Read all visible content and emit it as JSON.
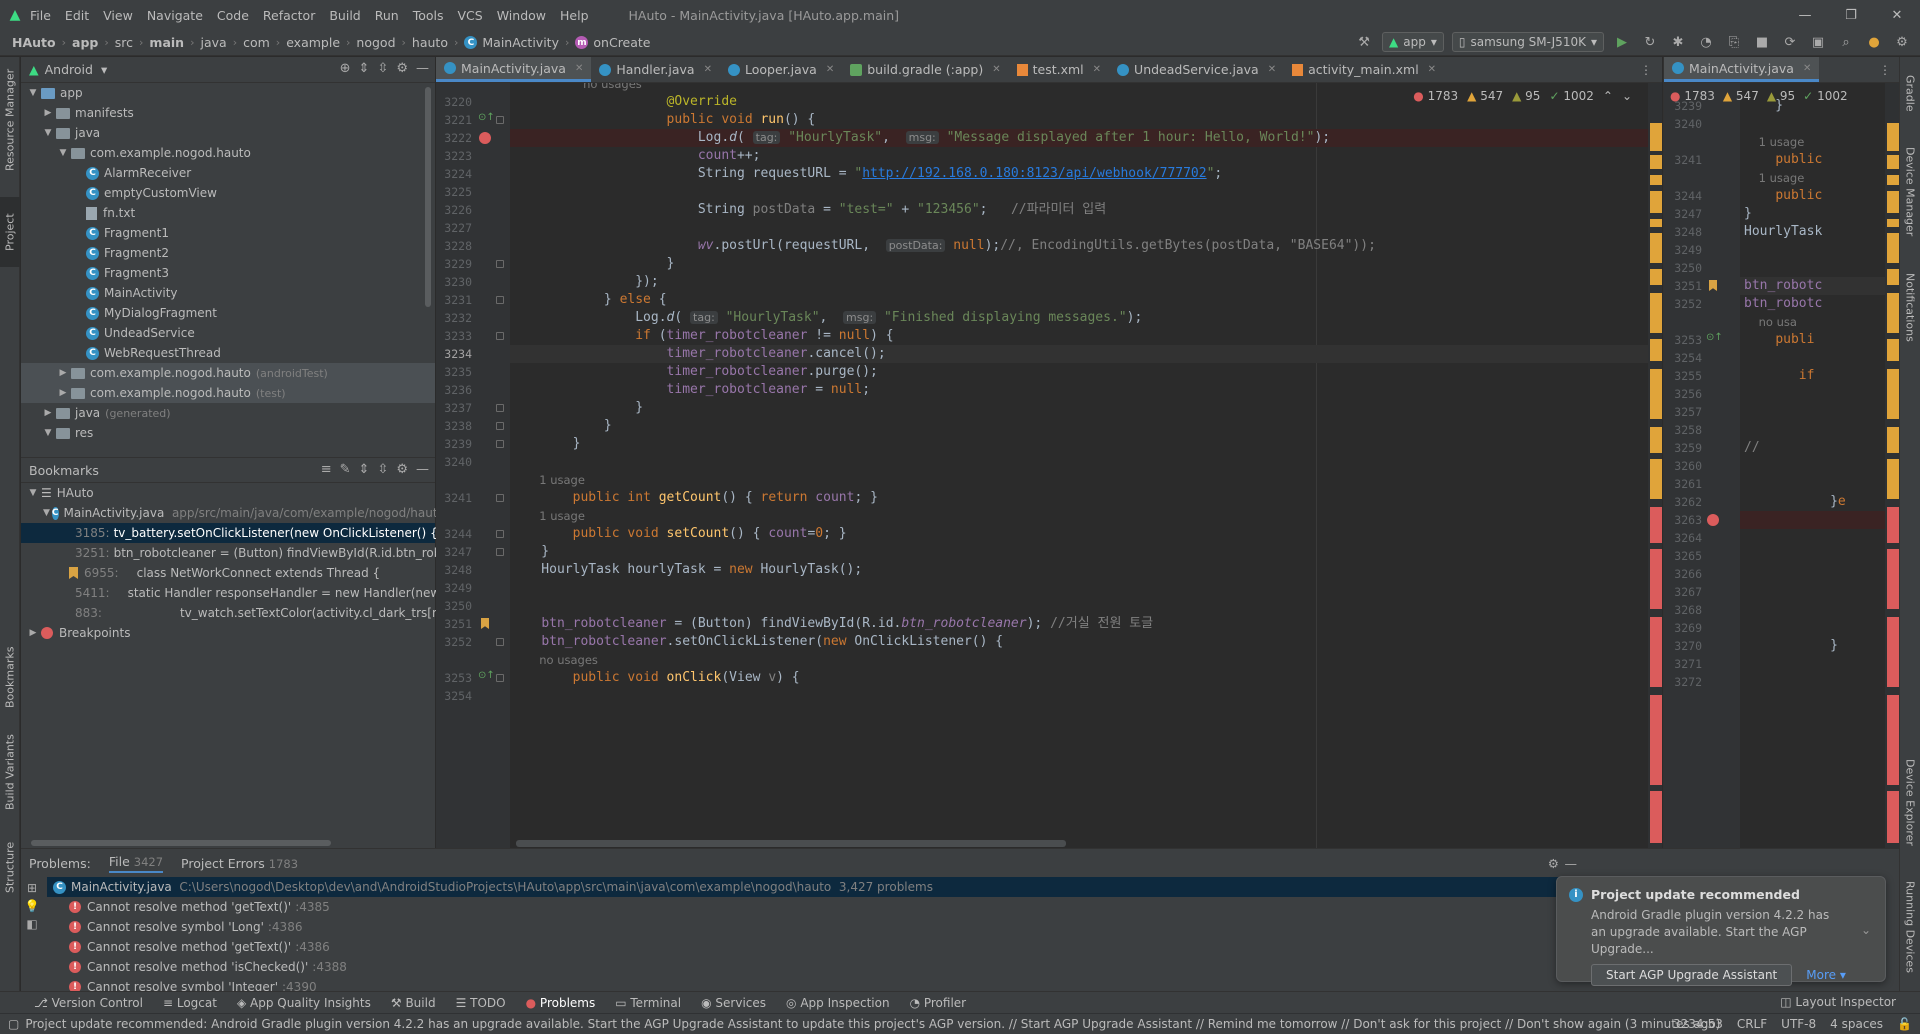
{
  "menu": [
    "File",
    "Edit",
    "View",
    "Navigate",
    "Code",
    "Refactor",
    "Build",
    "Run",
    "Tools",
    "VCS",
    "Window",
    "Help"
  ],
  "window_title": "HAuto - MainActivity.java [HAuto.app.main]",
  "breadcrumbs": [
    "HAuto",
    "app",
    "src",
    "main",
    "java",
    "com",
    "example",
    "nogod",
    "hauto",
    "MainActivity",
    "onCreate"
  ],
  "run_config": "app",
  "device": "samsung SM-J510K",
  "project_panel": {
    "view_mode": "Android",
    "tree": [
      {
        "label": "app",
        "extra": "",
        "icon": "folder"
      },
      {
        "label": "manifests",
        "extra": "",
        "icon": "folder"
      },
      {
        "label": "java",
        "extra": "",
        "icon": "folder"
      },
      {
        "label": "com.example.nogod.hauto",
        "extra": "",
        "icon": "package"
      },
      {
        "label": "AlarmReceiver",
        "extra": "",
        "icon": "class"
      },
      {
        "label": "emptyCustomView",
        "extra": "",
        "icon": "class"
      },
      {
        "label": "fn.txt",
        "extra": "",
        "icon": "file"
      },
      {
        "label": "Fragment1",
        "extra": "",
        "icon": "class"
      },
      {
        "label": "Fragment2",
        "extra": "",
        "icon": "class"
      },
      {
        "label": "Fragment3",
        "extra": "",
        "icon": "class"
      },
      {
        "label": "MainActivity",
        "extra": "",
        "icon": "class"
      },
      {
        "label": "MyDialogFragment",
        "extra": "",
        "icon": "class"
      },
      {
        "label": "UndeadService",
        "extra": "",
        "icon": "class"
      },
      {
        "label": "WebRequestThread",
        "extra": "",
        "icon": "class"
      },
      {
        "label": "com.example.nogod.hauto",
        "extra": "(androidTest)",
        "icon": "package"
      },
      {
        "label": "com.example.nogod.hauto",
        "extra": "(test)",
        "icon": "package"
      },
      {
        "label": "java",
        "extra": "(generated)",
        "icon": "folder"
      },
      {
        "label": "res",
        "extra": "",
        "icon": "folder"
      }
    ]
  },
  "bookmarks_panel": {
    "title": "Bookmarks",
    "root": "HAuto",
    "file": "MainActivity.java",
    "file_path": "app/src/main/java/com/example/nogod/hauto",
    "items": [
      {
        "line": "3185:",
        "text": "tv_battery.setOnClickListener(new OnClickListener() {"
      },
      {
        "line": "3251:",
        "text": "btn_robotcleaner = (Button) findViewById(R.id.btn_robo"
      },
      {
        "line": "6955:",
        "text": "class NetWorkConnect extends Thread {"
      },
      {
        "line": "5411:",
        "text": "static Handler responseHandler = new Handler(new H"
      },
      {
        "line": "883:",
        "text": "tv_watch.setTextColor(activity.cl_dark_trs[m"
      }
    ],
    "breakpoints": "Breakpoints"
  },
  "editor_tabs": [
    "MainActivity.java",
    "Handler.java",
    "Looper.java",
    "build.gradle (:app)",
    "test.xml",
    "UndeadService.java",
    "activity_main.xml"
  ],
  "split_tab": "MainActivity.java",
  "inspections": {
    "errors": "1783",
    "warnings": "547",
    "weak": "95",
    "ok": "1002"
  },
  "code_lines": [
    {
      "n": "",
      "html": "<span class=\"hint\">                    no usages</span>"
    },
    {
      "n": "3220",
      "html": "                    <span class=\"ann\">@Override</span>"
    },
    {
      "n": "3221",
      "html": "                    <span class=\"kw\">public void</span> <span class=\"fn\">run</span>() {"
    },
    {
      "n": "3222",
      "html": "                        Log.<span class=\"ital\">d</span>( <span class=\"inl\">tag:</span> <span class=\"str\">\"HourlyTask\"</span>,  <span class=\"inl\">msg:</span> <span class=\"str\">\"Message displayed after 1 hour: Hello, World!\"</span>);"
    },
    {
      "n": "3223",
      "html": "                        <span class=\"fld\">count</span>++;"
    },
    {
      "n": "3224",
      "html": "                        String requestURL = <span class=\"str\">\"<span class=\"url\">http://192.168.0.180:8123/api/webhook/777702</span>\"</span>;"
    },
    {
      "n": "3225",
      "html": ""
    },
    {
      "n": "3226",
      "html": "                        String <span class=\"cmt\">postData</span> = <span class=\"str\">\"test=\"</span> + <span class=\"str\">\"123456\"</span>;   <span class=\"cmt\">//파라미터 입력</span>"
    },
    {
      "n": "3227",
      "html": ""
    },
    {
      "n": "3228",
      "html": "                        <span class=\"fld ital\">wv</span>.postUrl(requestURL,  <span class=\"inl\">postData:</span> <span class=\"kw\">null</span>);<span class=\"cmt\">//, EncodingUtils.getBytes(postData, \"BASE64\"));</span>"
    },
    {
      "n": "3229",
      "html": "                    }"
    },
    {
      "n": "3230",
      "html": "                });"
    },
    {
      "n": "3231",
      "html": "            } <span class=\"kw\">else</span> {"
    },
    {
      "n": "3232",
      "html": "                Log.<span class=\"ital\">d</span>( <span class=\"inl\">tag:</span> <span class=\"str\">\"HourlyTask\"</span>,  <span class=\"inl\">msg:</span> <span class=\"str\">\"Finished displaying messages.\"</span>);"
    },
    {
      "n": "3233",
      "html": "                <span class=\"kw\">if</span> (<span class=\"fld\">timer_robotcleaner</span> != <span class=\"kw\">null</span>) {"
    },
    {
      "n": "3234",
      "html": "                    <span class=\"fld\">timer_robotcleaner</span>.cancel();"
    },
    {
      "n": "3235",
      "html": "                    <span class=\"fld\">timer_robotcleaner</span>.purge();"
    },
    {
      "n": "3236",
      "html": "                    <span class=\"fld\">timer_robotcleaner</span> = <span class=\"kw\">null</span>;"
    },
    {
      "n": "3237",
      "html": "                }"
    },
    {
      "n": "3238",
      "html": "            }"
    },
    {
      "n": "3239",
      "html": "        }"
    },
    {
      "n": "3240",
      "html": ""
    },
    {
      "n": "",
      "html": "<span class=\"hint\">        1 usage</span>"
    },
    {
      "n": "3241",
      "html": "        <span class=\"kw\">public int</span> <span class=\"fn\">getCount</span>() { <span class=\"kw\">return</span> <span class=\"fld\">count</span>; }"
    },
    {
      "n": "",
      "html": "<span class=\"hint\">        1 usage</span>"
    },
    {
      "n": "3244",
      "html": "        <span class=\"kw\">public void</span> <span class=\"fn\">setCount</span>() { <span class=\"fld\">count</span>=<span class=\"kw\">0</span>; }"
    },
    {
      "n": "3247",
      "html": "    }"
    },
    {
      "n": "3248",
      "html": "    HourlyTask hourlyTask = <span class=\"kw\">new</span> HourlyTask();"
    },
    {
      "n": "3249",
      "html": ""
    },
    {
      "n": "3250",
      "html": ""
    },
    {
      "n": "3251",
      "html": "    <span class=\"fld\">btn_robotcleaner</span> = (Button) findViewById(R.id.<span class=\"fld ital\">btn_robotcleaner</span>); <span class=\"cmt\">//거실 전원 토글</span>"
    },
    {
      "n": "3252",
      "html": "    <span class=\"fld\">btn_robotcleaner</span>.setOnClickListener(<span class=\"kw\">new</span> OnClickListener() {"
    },
    {
      "n": "",
      "html": "<span class=\"hint\">        no usages</span>"
    },
    {
      "n": "3253",
      "html": "        <span class=\"kw\">public void</span> <span class=\"fn\">onClick</span>(View <span class=\"cmt\">v</span>) {"
    },
    {
      "n": "3254",
      "html": ""
    }
  ],
  "split_lines": [
    {
      "n": "3239",
      "html": "    }"
    },
    {
      "n": "3240",
      "html": ""
    },
    {
      "n": "",
      "html": "<span class=\"hint\">    1 usage</span>"
    },
    {
      "n": "3241",
      "html": "    <span class=\"kw\">public</span>"
    },
    {
      "n": "",
      "html": "<span class=\"hint\">    1 usage</span>"
    },
    {
      "n": "3244",
      "html": "    <span class=\"kw\">public</span>"
    },
    {
      "n": "3247",
      "html": "}"
    },
    {
      "n": "3248",
      "html": "HourlyTask"
    },
    {
      "n": "3249",
      "html": ""
    },
    {
      "n": "3250",
      "html": ""
    },
    {
      "n": "3251",
      "html": "<span class=\"fld\">btn_robotc</span>"
    },
    {
      "n": "3252",
      "html": "<span class=\"fld\">btn_robotc</span>"
    },
    {
      "n": "",
      "html": "<span class=\"hint\">    no usa</span>"
    },
    {
      "n": "3253",
      "html": "    <span class=\"kw\">publi</span>"
    },
    {
      "n": "3254",
      "html": ""
    },
    {
      "n": "3255",
      "html": "       <span class=\"kw\">if</span>"
    },
    {
      "n": "3256",
      "html": ""
    },
    {
      "n": "3257",
      "html": ""
    },
    {
      "n": "3258",
      "html": ""
    },
    {
      "n": "3259",
      "html": "<span class=\"cmt\">//</span>"
    },
    {
      "n": "3260",
      "html": ""
    },
    {
      "n": "3261",
      "html": ""
    },
    {
      "n": "3262",
      "html": "           }<span class=\"kw\">e</span>"
    },
    {
      "n": "3263",
      "html": ""
    },
    {
      "n": "3264",
      "html": ""
    },
    {
      "n": "3265",
      "html": ""
    },
    {
      "n": "3266",
      "html": ""
    },
    {
      "n": "3267",
      "html": ""
    },
    {
      "n": "3268",
      "html": ""
    },
    {
      "n": "3269",
      "html": ""
    },
    {
      "n": "3270",
      "html": "           }"
    },
    {
      "n": "3271",
      "html": ""
    },
    {
      "n": "3272",
      "html": ""
    }
  ],
  "problems": {
    "title": "Problems:",
    "tabs": [
      {
        "label": "File",
        "count": "3427"
      },
      {
        "label": "Project Errors",
        "count": "1783"
      }
    ],
    "file": "MainActivity.java",
    "path": "C:\\Users\\nogod\\Desktop\\dev\\and\\AndroidStudioProjects\\HAuto\\app\\src\\main\\java\\com\\example\\nogod\\hauto",
    "count": "3,427 problems",
    "items": [
      {
        "text": "Cannot resolve method 'getText()'",
        "loc": ":4385"
      },
      {
        "text": "Cannot resolve symbol 'Long'",
        "loc": ":4386"
      },
      {
        "text": "Cannot resolve method 'getText()'",
        "loc": ":4386"
      },
      {
        "text": "Cannot resolve method 'isChecked()'",
        "loc": ":4388"
      },
      {
        "text": "Cannot resolve symbol 'Integer'",
        "loc": ":4390"
      }
    ]
  },
  "notification": {
    "title": "Project update recommended",
    "body": "Android Gradle plugin version 4.2.2 has an upgrade available. Start the AGP Upgrade...",
    "button": "Start AGP Upgrade Assistant",
    "more": "More"
  },
  "tool_windows": [
    "Version Control",
    "Logcat",
    "App Quality Insights",
    "Build",
    "TODO",
    "Problems",
    "Terminal",
    "Services",
    "App Inspection",
    "Profiler"
  ],
  "layout_inspector": "Layout Inspector",
  "status": {
    "message": "Project update recommended: Android Gradle plugin version 4.2.2 has an upgrade available.  Start the AGP Upgrade Assistant to update this project's AGP version. // Start AGP Upgrade Assistant // Remind me tomorrow // Don't ask for this project // Don't show again (3 minutes ago)",
    "position": "3234:53",
    "line_sep": "CRLF",
    "encoding": "UTF-8",
    "indent": "4 spaces"
  },
  "left_strip": [
    "Resource Manager",
    "Project",
    "Bookmarks",
    "Build Variants",
    "Structure"
  ],
  "right_strip": [
    "Gradle",
    "Device Manager",
    "Notifications",
    "Device Explorer",
    "Running Devices"
  ],
  "colors": {
    "accent": "#4a88c7",
    "error": "#db5c5c",
    "warning": "#e0a43a",
    "bg": "#2b2b2b",
    "panel": "#3c3f41"
  }
}
